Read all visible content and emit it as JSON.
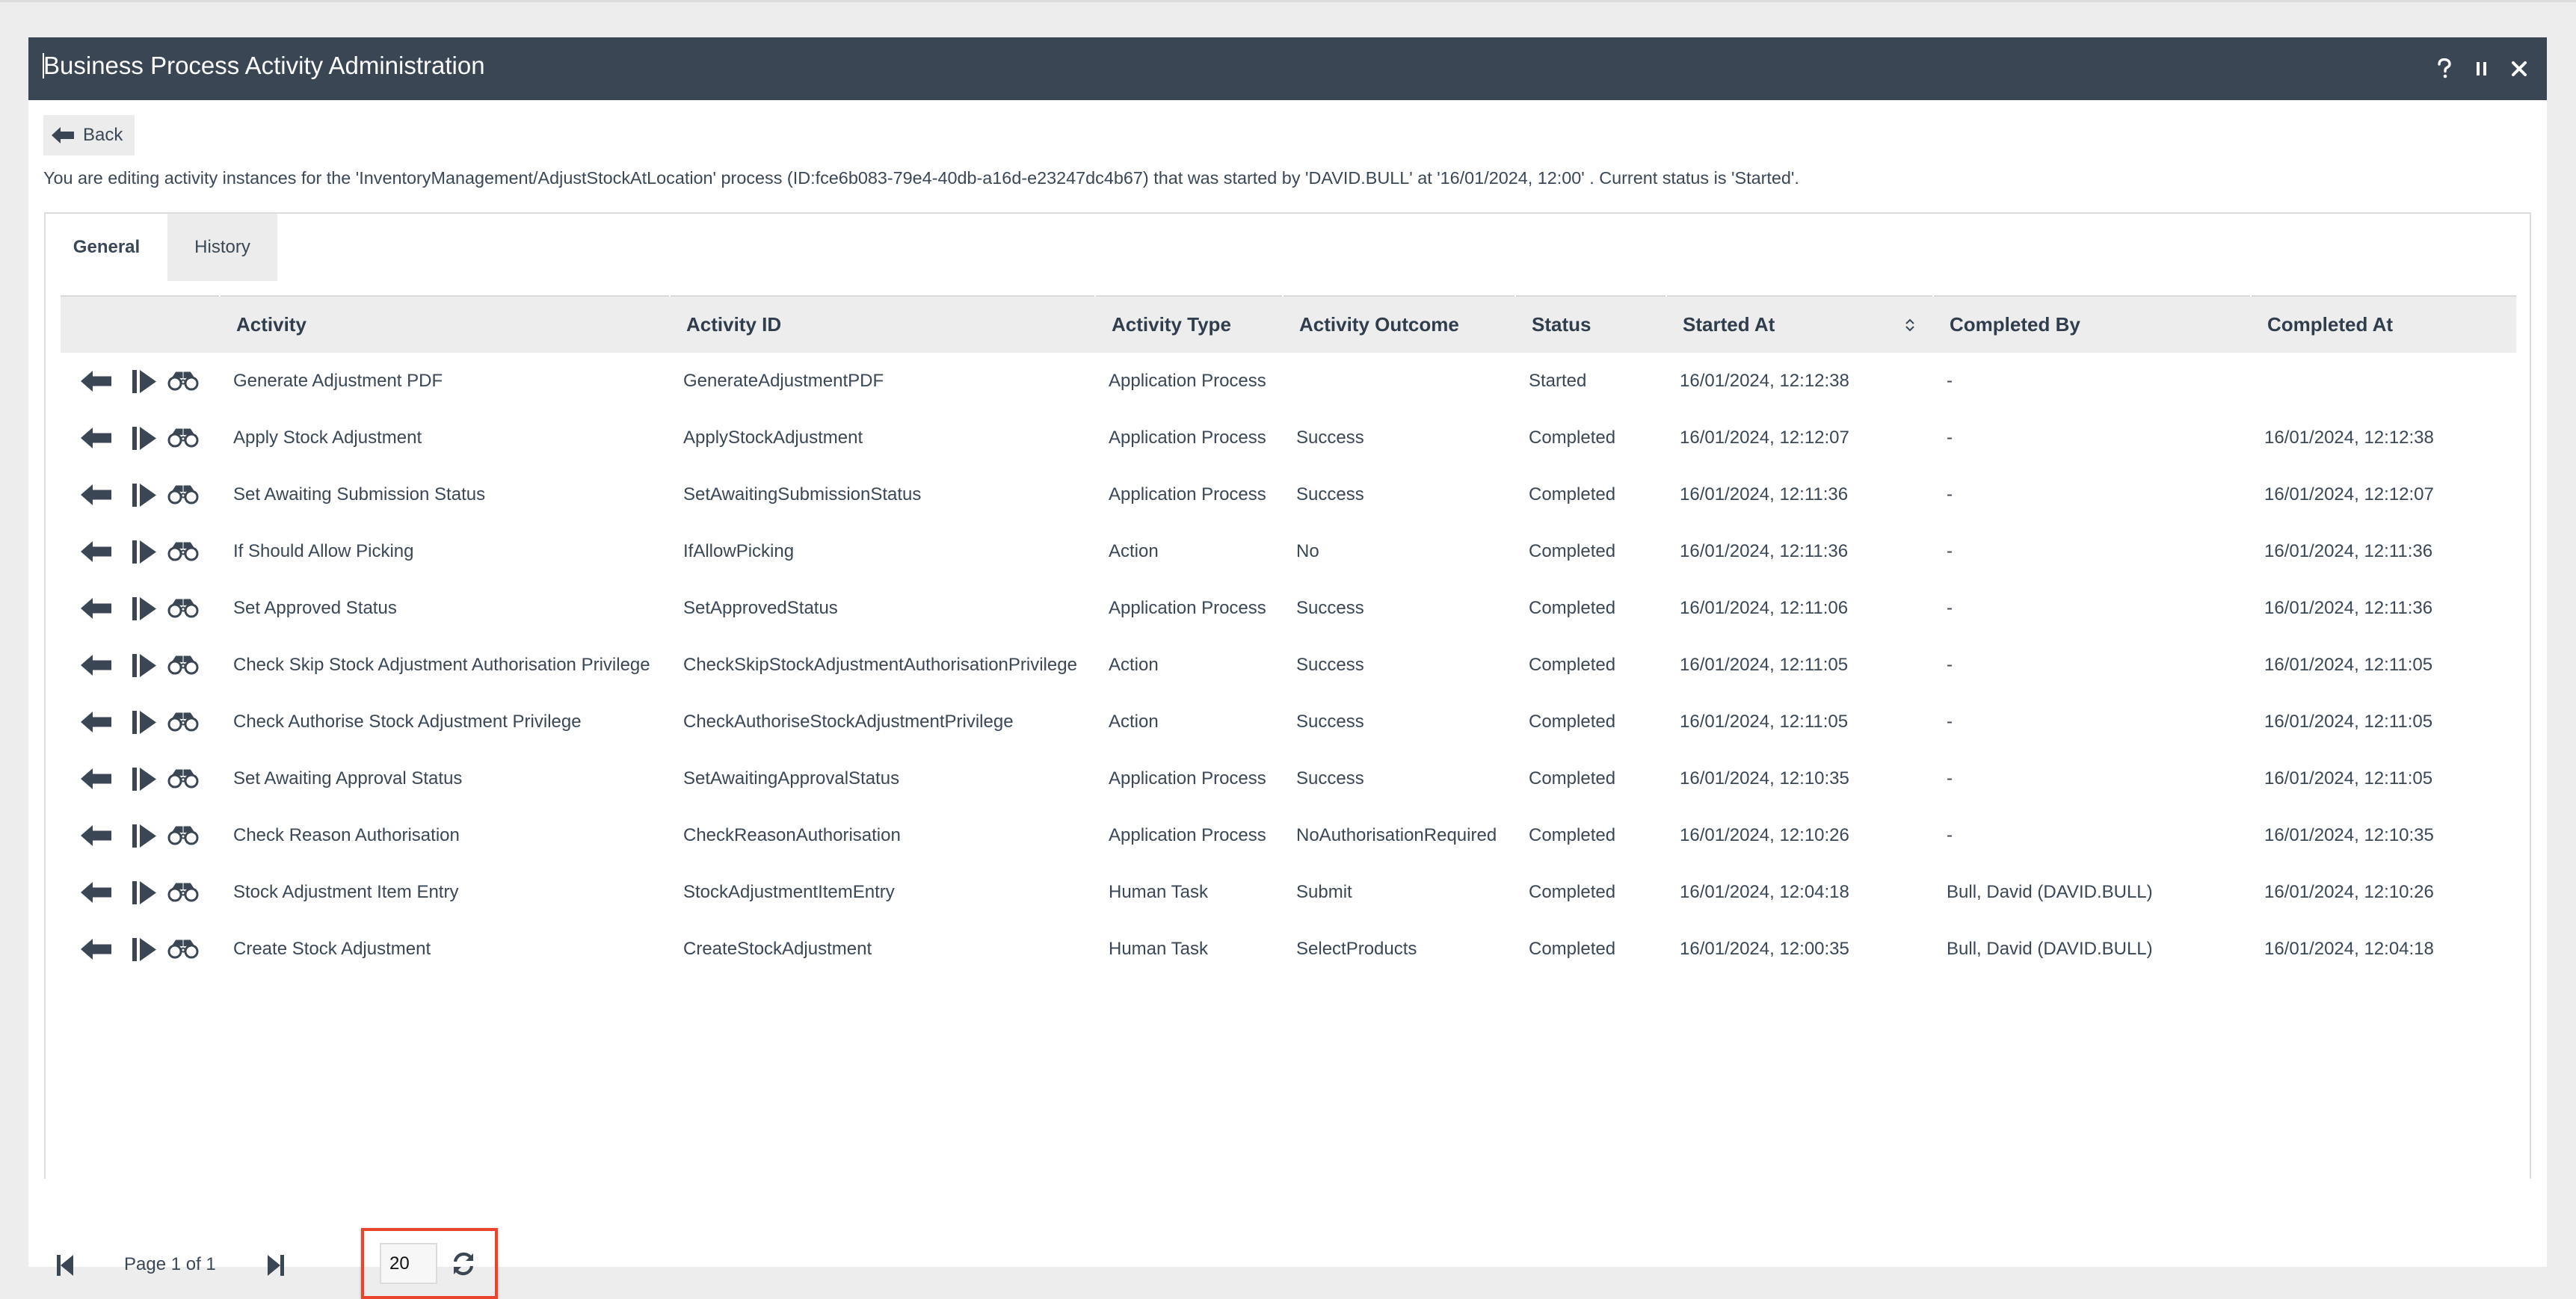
{
  "window": {
    "title": "Business Process Activity Administration",
    "actions": [
      {
        "name": "help",
        "icon": "question-icon"
      },
      {
        "name": "pause",
        "icon": "pause-icon"
      },
      {
        "name": "close",
        "icon": "close-icon"
      }
    ]
  },
  "back_button": {
    "label": "Back",
    "icon": "arrow-left-icon"
  },
  "description": "You are editing activity instances for the 'InventoryManagement/AdjustStockAtLocation' process (ID:fce6b083-79e4-40db-a16d-e23247dc4b67) that was started by 'DAVID.BULL' at '16/01/2024, 12:00' . Current status is 'Started'.",
  "tabs": [
    {
      "label": "General",
      "active": true
    },
    {
      "label": "History",
      "active": false
    }
  ],
  "table": {
    "columns": [
      "",
      "Activity",
      "Activity ID",
      "Activity Type",
      "Activity Outcome",
      "Status",
      "Started At",
      "Completed By",
      "Completed At"
    ],
    "sortable_column": "Started At",
    "row_actions": [
      "arrow-left-icon",
      "step-forward-icon",
      "binoculars-icon"
    ],
    "rows": [
      {
        "activity": "Generate Adjustment PDF",
        "activity_id": "GenerateAdjustmentPDF",
        "type": "Application Process",
        "outcome": "",
        "status": "Started",
        "started_at": "16/01/2024, 12:12:38",
        "completed_by": "-",
        "completed_at": ""
      },
      {
        "activity": "Apply Stock Adjustment",
        "activity_id": "ApplyStockAdjustment",
        "type": "Application Process",
        "outcome": "Success",
        "status": "Completed",
        "started_at": "16/01/2024, 12:12:07",
        "completed_by": "-",
        "completed_at": "16/01/2024, 12:12:38"
      },
      {
        "activity": "Set Awaiting Submission Status",
        "activity_id": "SetAwaitingSubmissionStatus",
        "type": "Application Process",
        "outcome": "Success",
        "status": "Completed",
        "started_at": "16/01/2024, 12:11:36",
        "completed_by": "-",
        "completed_at": "16/01/2024, 12:12:07"
      },
      {
        "activity": "If Should Allow Picking",
        "activity_id": "IfAllowPicking",
        "type": "Action",
        "outcome": "No",
        "status": "Completed",
        "started_at": "16/01/2024, 12:11:36",
        "completed_by": "-",
        "completed_at": "16/01/2024, 12:11:36"
      },
      {
        "activity": "Set Approved Status",
        "activity_id": "SetApprovedStatus",
        "type": "Application Process",
        "outcome": "Success",
        "status": "Completed",
        "started_at": "16/01/2024, 12:11:06",
        "completed_by": "-",
        "completed_at": "16/01/2024, 12:11:36"
      },
      {
        "activity": "Check Skip Stock Adjustment Authorisation Privilege",
        "activity_id": "CheckSkipStockAdjustmentAuthorisationPrivilege",
        "type": "Action",
        "outcome": "Success",
        "status": "Completed",
        "started_at": "16/01/2024, 12:11:05",
        "completed_by": "-",
        "completed_at": "16/01/2024, 12:11:05"
      },
      {
        "activity": "Check Authorise Stock Adjustment Privilege",
        "activity_id": "CheckAuthoriseStockAdjustmentPrivilege",
        "type": "Action",
        "outcome": "Success",
        "status": "Completed",
        "started_at": "16/01/2024, 12:11:05",
        "completed_by": "-",
        "completed_at": "16/01/2024, 12:11:05"
      },
      {
        "activity": "Set Awaiting Approval Status",
        "activity_id": "SetAwaitingApprovalStatus",
        "type": "Application Process",
        "outcome": "Success",
        "status": "Completed",
        "started_at": "16/01/2024, 12:10:35",
        "completed_by": "-",
        "completed_at": "16/01/2024, 12:11:05"
      },
      {
        "activity": "Check Reason Authorisation",
        "activity_id": "CheckReasonAuthorisation",
        "type": "Application Process",
        "outcome": "NoAuthorisationRequired",
        "status": "Completed",
        "started_at": "16/01/2024, 12:10:26",
        "completed_by": "-",
        "completed_at": "16/01/2024, 12:10:35"
      },
      {
        "activity": "Stock Adjustment Item Entry",
        "activity_id": "StockAdjustmentItemEntry",
        "type": "Human Task",
        "outcome": "Submit",
        "status": "Completed",
        "started_at": "16/01/2024, 12:04:18",
        "completed_by": "Bull, David (DAVID.BULL)",
        "completed_at": "16/01/2024, 12:10:26"
      },
      {
        "activity": "Create Stock Adjustment",
        "activity_id": "CreateStockAdjustment",
        "type": "Human Task",
        "outcome": "SelectProducts",
        "status": "Completed",
        "started_at": "16/01/2024, 12:00:35",
        "completed_by": "Bull, David (DAVID.BULL)",
        "completed_at": "16/01/2024, 12:04:18"
      }
    ]
  },
  "pager": {
    "page_text": "Page 1 of 1",
    "page_size": "20",
    "first_icon": "first-page-icon",
    "last_icon": "last-page-icon",
    "refresh_icon": "refresh-icon"
  },
  "colors": {
    "titlebar": "#3b4654",
    "text": "#3a4756",
    "header_bg": "#ededed",
    "highlight": "#e8452c"
  }
}
